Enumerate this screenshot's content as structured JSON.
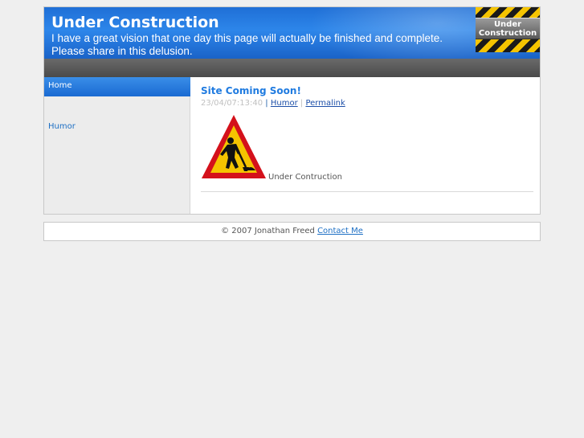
{
  "header": {
    "title": "Under Construction",
    "tagline": "I have a great vision that one day this page will actually be finished and complete. Please share in this delusion.",
    "badge_text": "Under\nConstruction"
  },
  "sidebar": {
    "items": [
      {
        "label": "Home",
        "active": true
      },
      {
        "label": "Humor",
        "active": false
      }
    ]
  },
  "post": {
    "title": "Site Coming Soon!",
    "timestamp": "23/04/07:13:40",
    "category_link": "Humor",
    "permalink_label": "Permalink",
    "body_text": "Under Contruction",
    "separator": "|"
  },
  "footer": {
    "copyright": "© 2007 Jonathan Freed",
    "contact_label": "Contact Me"
  },
  "colors": {
    "header_blue": "#2d86ea",
    "link_blue": "#1d6fc4",
    "title_blue": "#1f7be0",
    "warning_red": "#d4111b",
    "warning_yellow": "#f5c400"
  },
  "icons": {
    "badge": "under-construction-badge-icon",
    "post_image": "road-work-warning-icon"
  }
}
